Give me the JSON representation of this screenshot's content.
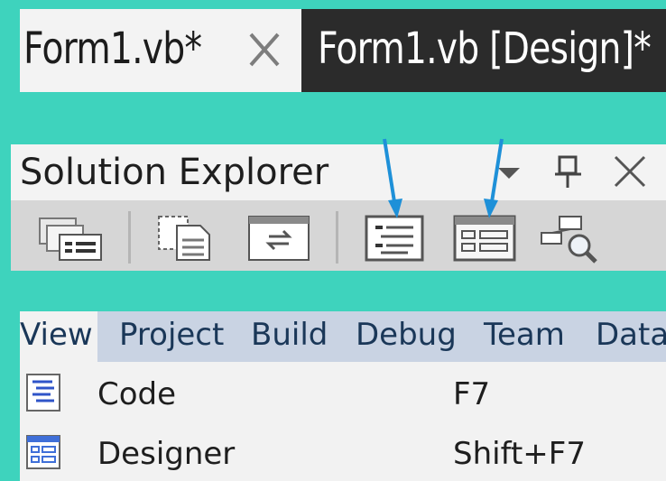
{
  "tabs": [
    {
      "label": "Form1.vb*",
      "active": false,
      "close_icon": "close-icon"
    },
    {
      "label": "Form1.vb [Design]*",
      "active": true
    }
  ],
  "solution_explorer": {
    "title": "Solution Explorer",
    "title_controls": [
      "dropdown-arrow-icon",
      "pin-icon",
      "close-icon"
    ],
    "toolbar": [
      "properties-icon",
      "show-all-files-icon",
      "refresh-icon",
      "view-code-icon",
      "view-designer-icon",
      "class-diagram-icon"
    ],
    "annotation_color": "#1e90d8"
  },
  "menu": {
    "items": [
      "View",
      "Project",
      "Build",
      "Debug",
      "Team",
      "Data"
    ],
    "active": "View",
    "dropdown": [
      {
        "label": "Code",
        "shortcut": "F7",
        "icon": "code-icon"
      },
      {
        "label": "Designer",
        "shortcut": "Shift+F7",
        "icon": "designer-icon"
      }
    ]
  },
  "colors": {
    "background": "#3ed3bd",
    "active_tab": "#2b2b2b",
    "menubar": "#c9d3e3",
    "menu_text": "#1a3758"
  }
}
